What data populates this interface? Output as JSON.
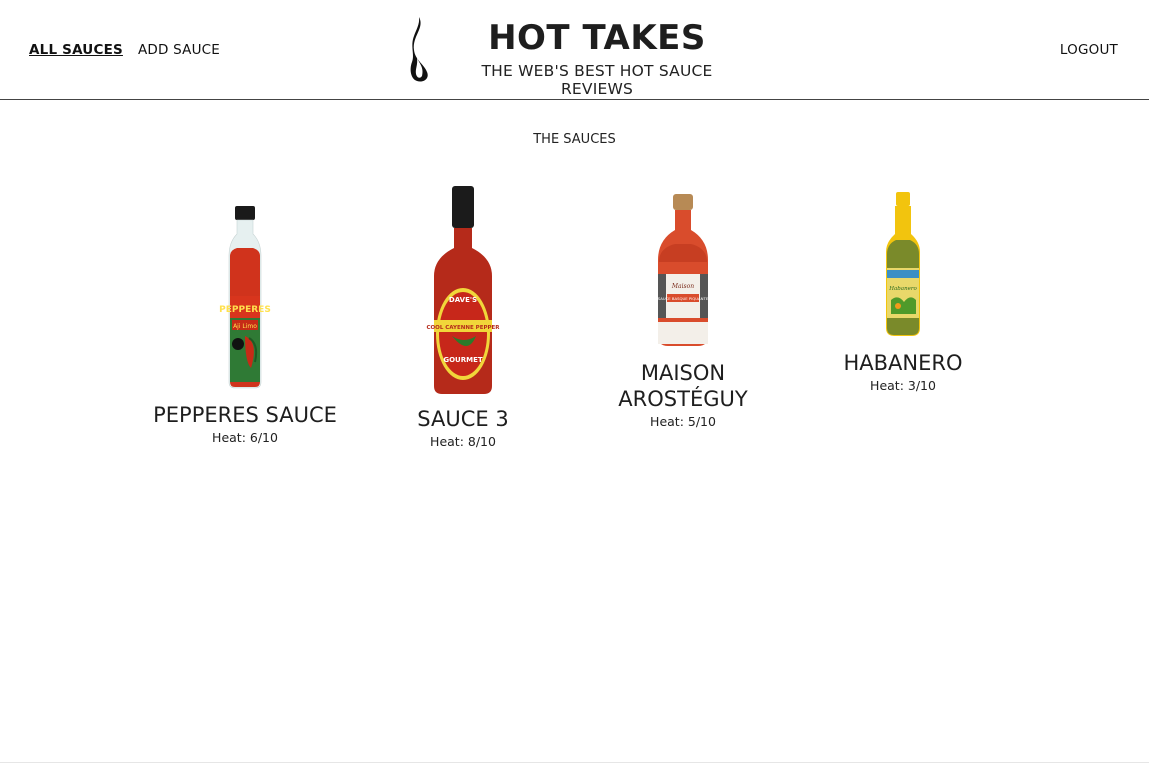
{
  "nav": {
    "all_sauces": "ALL SAUCES",
    "add_sauce": "ADD SAUCE",
    "logout": "LOGOUT"
  },
  "brand": {
    "title": "HOT TAKES",
    "subtitle": "THE WEB'S BEST HOT SAUCE REVIEWS",
    "logo_icon": "flame-icon"
  },
  "section_title": "THE SAUCES",
  "sauces": [
    {
      "name": "PEPPERES SAUCE",
      "heat": "Heat: 6/10",
      "label_top": "PEPPERES",
      "label_mid": "Aji Limo"
    },
    {
      "name": "SAUCE 3",
      "heat": "Heat: 8/10",
      "label_top": "DAVE'S",
      "label_mid": "COOL CAYENNE PEPPER",
      "label_bot": "GOURMET"
    },
    {
      "name": "MAISON AROSTÉGUY",
      "heat": "Heat: 5/10",
      "label_mid": "SAUCE BASQUE PIQUANTE"
    },
    {
      "name": "HABANERO",
      "heat": "Heat: 3/10",
      "label_mid": "Habanero"
    }
  ],
  "colors": {
    "text": "#222222",
    "header_rule": "#444444",
    "sauce_red": "#d0331c",
    "habanero_green": "#7a8a2a",
    "cap_yellow": "#f2c40e"
  }
}
